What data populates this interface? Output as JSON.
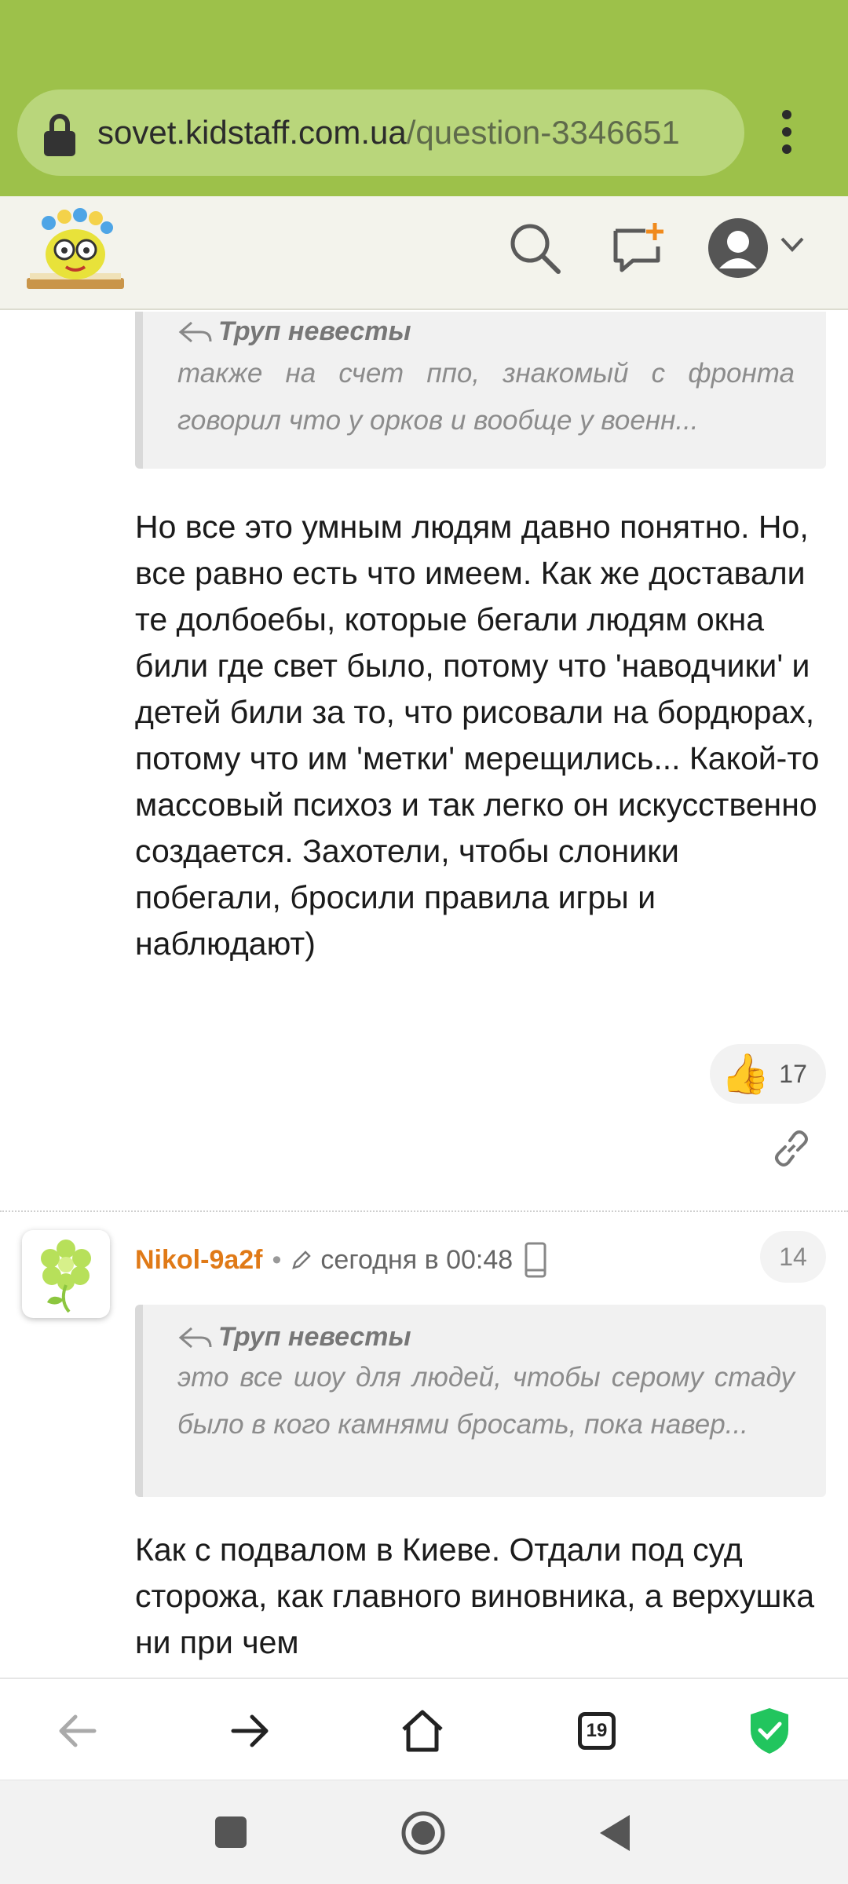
{
  "browser": {
    "url_host": "sovet.kidstaff.com.ua",
    "url_path": "/question-3346651",
    "menu_icon": "kebab-menu-icon"
  },
  "site_header": {
    "logo": "kidstaff-logo",
    "search_icon": "search-icon",
    "new_question_icon": "new-message-icon",
    "profile_icon": "user-avatar-icon"
  },
  "post1": {
    "quote_author": "Труп невесты",
    "quote_text": "также на счет ппо, знакомый с фронта говорил что у орков и вообще у военн...",
    "body": "Но все это умным людям давно понятно. Но, все равно есть что имеем. Как же доставали те долбоебы, которые бегали людям окна били где свет было, потому что 'наводчики' и детей били за то, что рисовали на бордюрах, потому что им 'метки' мерещились... Какой-то массовый психоз и так легко он искусственно создается. Захотели, чтобы слоники побегали, бросили правила игры и наблюдают)",
    "likes": "17"
  },
  "post2": {
    "username": "Nikol-9a2f",
    "separator": "•",
    "time": "сегодня в 00:48",
    "number": "14",
    "quote_author": "Труп невесты",
    "quote_text": "это все шоу для людей, чтобы серому стаду было в кого камнями бросать, пока навер...",
    "body": "Как с подвалом в Киеве. Отдали под суд сторожа, как главного виновника, а верхушка ни при чем"
  },
  "toolbar": {
    "tabs_count": "19"
  },
  "colors": {
    "browser_bar": "#9dc14a",
    "username": "#e07a17",
    "shield": "#22c55e"
  }
}
